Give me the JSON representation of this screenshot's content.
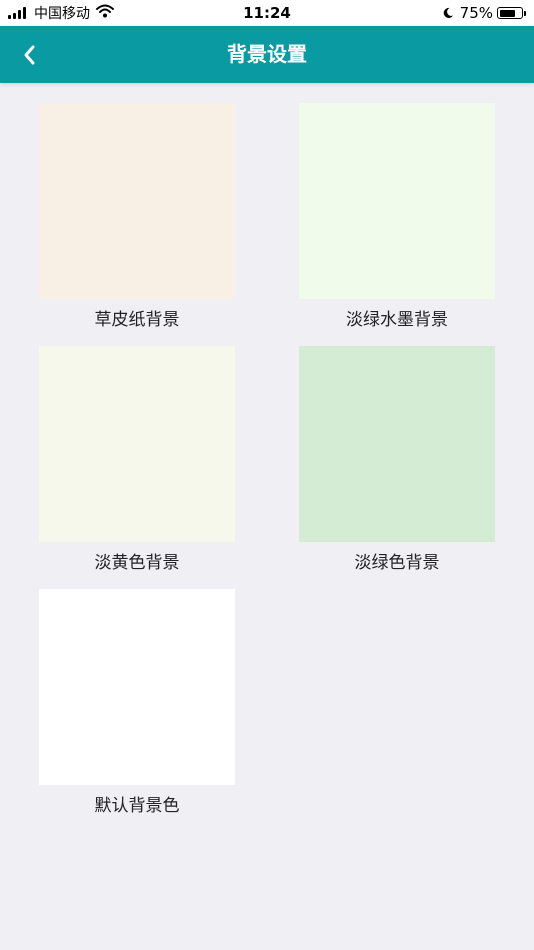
{
  "status_bar": {
    "carrier": "中国移动",
    "time": "11:24",
    "battery_percent": "75%",
    "battery_level": 0.75,
    "icons": [
      "signal-icon",
      "wifi-icon",
      "moon-icon",
      "battery-icon"
    ]
  },
  "nav": {
    "title": "背景设置",
    "back_icon": "back-chevron-icon",
    "color": "#0a9aa1"
  },
  "backgrounds": [
    {
      "label": "草皮纸背景",
      "color": "#f8efe5"
    },
    {
      "label": "淡绿水墨背景",
      "color": "#f0fbec"
    },
    {
      "label": "淡黄色背景",
      "color": "#f5f8eb"
    },
    {
      "label": "淡绿色背景",
      "color": "#d4ecd3"
    },
    {
      "label": "默认背景色",
      "color": "#ffffff"
    }
  ]
}
